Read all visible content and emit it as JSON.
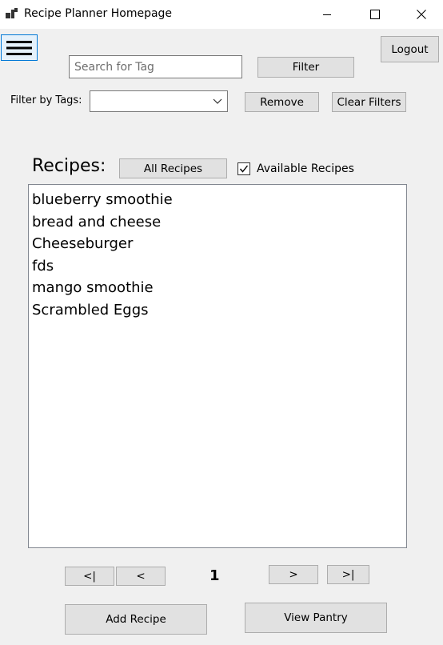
{
  "window": {
    "title": "Recipe Planner Homepage"
  },
  "header": {
    "logout_label": "Logout"
  },
  "search": {
    "placeholder": "Search for Tag",
    "filter_label": "Filter"
  },
  "tag_filter": {
    "label": "Filter by Tags:",
    "selected": "",
    "remove_label": "Remove",
    "clear_label": "Clear Filters"
  },
  "recipes": {
    "heading": "Recipes:",
    "all_label": "All Recipes",
    "available_label": "Available Recipes",
    "available_checked": true,
    "items": [
      "blueberry smoothie",
      "bread and cheese",
      "Cheeseburger",
      "fds",
      "mango smoothie",
      "Scrambled Eggs"
    ]
  },
  "pagination": {
    "first_label": "<|",
    "prev_label": "<",
    "page": "1",
    "next_label": ">",
    "last_label": ">|"
  },
  "actions": {
    "add_label": "Add Recipe",
    "pantry_label": "View Pantry"
  },
  "colors": {
    "window_bg": "#f0f0f0",
    "button_bg": "#e1e1e1",
    "button_border": "#adadad",
    "accent": "#0078d7",
    "menu_button_bg": "#e5f1fb"
  }
}
